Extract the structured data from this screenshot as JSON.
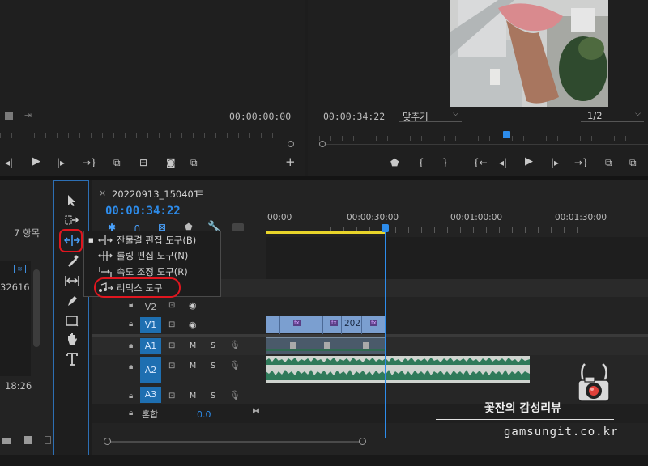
{
  "source_monitor": {
    "timecode": "00:00:00:00"
  },
  "program_monitor": {
    "timecode": "00:00:34:22",
    "fit_label": "맞추기",
    "resolution": "1/2"
  },
  "project_panel": {
    "items_count": "7 항목",
    "clip_number": "32616",
    "duration": "18:26"
  },
  "timeline": {
    "tab_close": "×",
    "sequence_name": "20220913_150401",
    "tab_menu": "≡",
    "timecode": "00:00:34:22",
    "ruler": [
      "00:00",
      "00:00:30:00",
      "00:01:00:00",
      "00:01:30:00"
    ],
    "mix_label": "혼합",
    "mix_value": "0.0",
    "tracks": {
      "v2": "V2",
      "v1": "V1",
      "a1": "A1",
      "a2": "A2",
      "a3": "A3",
      "m": "M",
      "s": "S"
    },
    "v1_clip_label": "202",
    "fx": "fx"
  },
  "tool_menu": {
    "items": [
      {
        "label": "잔물결 편집 도구(B)",
        "selected": true
      },
      {
        "label": "롤링 편집 도구(N)",
        "selected": false
      },
      {
        "label": "속도 조정 도구(R)",
        "selected": false
      },
      {
        "label": "리믹스 도구",
        "selected": false,
        "highlighted": true
      }
    ]
  },
  "watermark": {
    "title": "꽃잔의 감성리뷰",
    "url": "gamsungit.co.kr"
  },
  "colors": {
    "accent_blue": "#2d8ceb",
    "highlight_red": "#e0161f",
    "playhead": "#2d8ceb",
    "work_area": "#e8d42a",
    "video_clip": "#7b9fd0",
    "audio_clip": "#3a8a6a"
  }
}
